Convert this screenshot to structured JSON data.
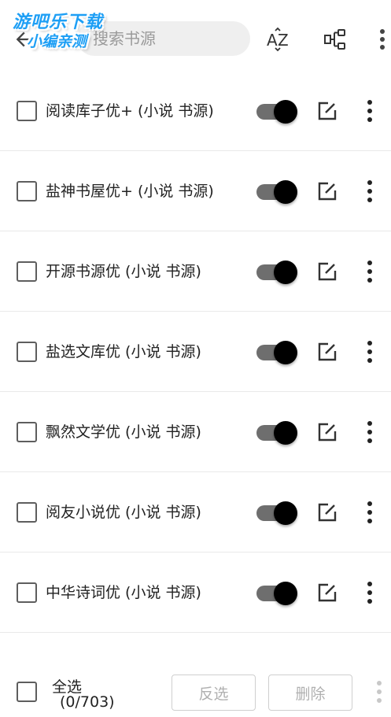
{
  "header": {
    "search_placeholder": "搜索书源",
    "watermark_line1": "游吧乐下载",
    "watermark_line2": "小编亲测",
    "icons": {
      "back": "arrow-left-icon",
      "sort": "az-sort-icon",
      "group": "group-icon",
      "more": "more-vertical-icon"
    }
  },
  "sources": [
    {
      "name": "阅读库子优+ (小说 书源)",
      "enabled": true,
      "checked": false
    },
    {
      "name": "盐神书屋优+ (小说 书源)",
      "enabled": true,
      "checked": false
    },
    {
      "name": "开源书源优 (小说 书源)",
      "enabled": true,
      "checked": false
    },
    {
      "name": "盐选文库优 (小说 书源)",
      "enabled": true,
      "checked": false
    },
    {
      "name": "飘然文学优 (小说 书源)",
      "enabled": true,
      "checked": false
    },
    {
      "name": "阅友小说优 (小说 书源)",
      "enabled": true,
      "checked": false
    },
    {
      "name": "中华诗词优 (小说 书源)",
      "enabled": true,
      "checked": false
    }
  ],
  "bottom": {
    "select_all_label": "全选",
    "count": "(0/703)",
    "invert_label": "反选",
    "delete_label": "删除"
  },
  "colors": {
    "toggle_thumb": "#000000",
    "toggle_track": "#6e6e6e",
    "watermark": "#1e9ff5"
  }
}
